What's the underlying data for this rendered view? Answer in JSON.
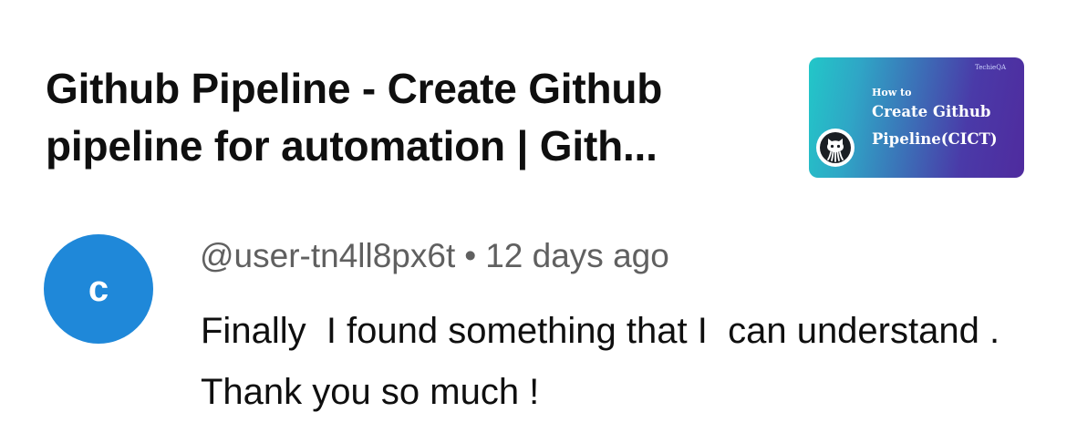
{
  "video": {
    "title": "Github Pipeline - Create Github pipeline for automation | Gith...",
    "thumbnail": {
      "brand": "TechieQA",
      "how_to": "How to",
      "line1": "Create Github",
      "line2": "Pipeline(CICT)",
      "logo_icon": "github-octocat-icon"
    }
  },
  "comment": {
    "avatar_letter": "c",
    "author": "@user-tn4ll8px6t",
    "separator": "•",
    "time": "12 days ago",
    "text": "Finally  I found something that I  can understand . Thank you so much !"
  },
  "colors": {
    "avatar": "#1f88d9",
    "meta_text": "#606060",
    "primary_text": "#0f0f0f"
  }
}
